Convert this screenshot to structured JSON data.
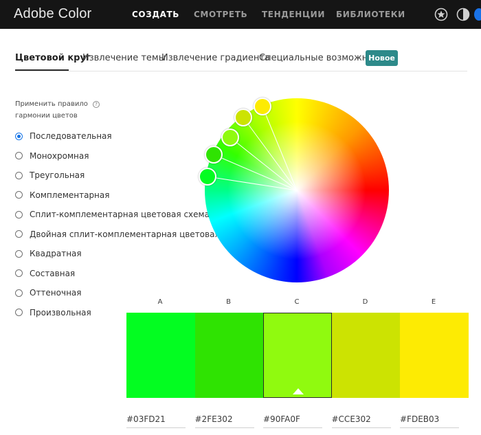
{
  "app": {
    "brand": "Adobe Color",
    "nav": [
      "СОЗДАТЬ",
      "СМОТРЕТЬ",
      "ТЕНДЕНЦИИ",
      "БИБЛИОТЕКИ"
    ],
    "icons": [
      "star-icon",
      "contrast-icon"
    ]
  },
  "tabs": {
    "items": [
      "Цветовой круг",
      "Извлечение темы",
      "Извлечение градиента",
      "Специальные возможности"
    ],
    "badge": "Новое"
  },
  "harmony": {
    "label": "Применить правило гармонии цветов",
    "help": "?",
    "options": [
      {
        "label": "Последовательная",
        "selected": true
      },
      {
        "label": "Монохромная",
        "selected": false
      },
      {
        "label": "Треугольная",
        "selected": false
      },
      {
        "label": "Комплементарная",
        "selected": false
      },
      {
        "label": "Сплит-комплементарная цветовая схема",
        "selected": false
      },
      {
        "label": "Двойная сплит-комплементарная цветовая схема",
        "selected": false
      },
      {
        "label": "Квадратная",
        "selected": false
      },
      {
        "label": "Составная",
        "selected": false
      },
      {
        "label": "Оттеночная",
        "selected": false
      },
      {
        "label": "Произвольная",
        "selected": false
      }
    ]
  },
  "swatches": [
    {
      "letter": "A",
      "hex": "#03FD21",
      "color": "#03FD21"
    },
    {
      "letter": "B",
      "hex": "#2FE302",
      "color": "#2FE302"
    },
    {
      "letter": "C",
      "hex": "#90FA0F",
      "color": "#90FA0F",
      "selected": true
    },
    {
      "letter": "D",
      "hex": "#CCE302",
      "color": "#CCE302"
    },
    {
      "letter": "E",
      "hex": "#FDEB03",
      "color": "#FDEB03"
    }
  ]
}
